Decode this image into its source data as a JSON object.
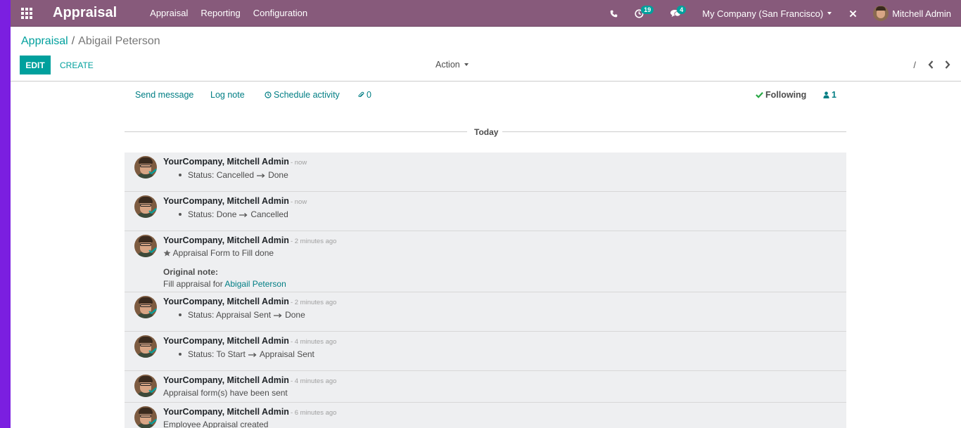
{
  "navbar": {
    "brand": "Appraisal",
    "menu": [
      "Appraisal",
      "Reporting",
      "Configuration"
    ],
    "activity_count": "19",
    "message_count": "4",
    "company": "My Company (San Francisco)",
    "user": "Mitchell Admin"
  },
  "control_panel": {
    "breadcrumb_parent": "Appraisal",
    "breadcrumb_sep": "/",
    "breadcrumb_current": "Abigail Peterson",
    "edit_label": "EDIT",
    "create_label": "CREATE",
    "action_label": "Action",
    "pager_value": "/"
  },
  "chatter": {
    "send_message": "Send message",
    "log_note": "Log note",
    "schedule_activity": "Schedule activity",
    "attachments": "0",
    "following": "Following",
    "followers": "1",
    "today": "Today"
  },
  "messages": [
    {
      "author": "YourCompany, Mitchell Admin",
      "date": "- now",
      "field": "Status:",
      "old": "Cancelled",
      "new": "Done"
    },
    {
      "author": "YourCompany, Mitchell Admin",
      "date": "- now",
      "field": "Status:",
      "old": "Done",
      "new": "Cancelled"
    },
    {
      "author": "YourCompany, Mitchell Admin",
      "date": "- 2 minutes ago",
      "activity": "Appraisal Form to Fill done",
      "orig_label": "Original note:",
      "orig_text": "Fill appraisal for",
      "orig_link": "Abigail Peterson"
    },
    {
      "author": "YourCompany, Mitchell Admin",
      "date": "- 2 minutes ago",
      "field": "Status:",
      "old": "Appraisal Sent",
      "new": "Done"
    },
    {
      "author": "YourCompany, Mitchell Admin",
      "date": "- 4 minutes ago",
      "field": "Status:",
      "old": "To Start",
      "new": "Appraisal Sent"
    },
    {
      "author": "YourCompany, Mitchell Admin",
      "date": "- 4 minutes ago",
      "body": "Appraisal form(s) have been sent"
    },
    {
      "author": "YourCompany, Mitchell Admin",
      "date": "- 6 minutes ago",
      "body": "Employee Appraisal created"
    }
  ],
  "colors": {
    "navbar": "#875a7b",
    "accent": "#00a09d",
    "link": "#017e84",
    "left_strip": "#7b1fe0"
  }
}
